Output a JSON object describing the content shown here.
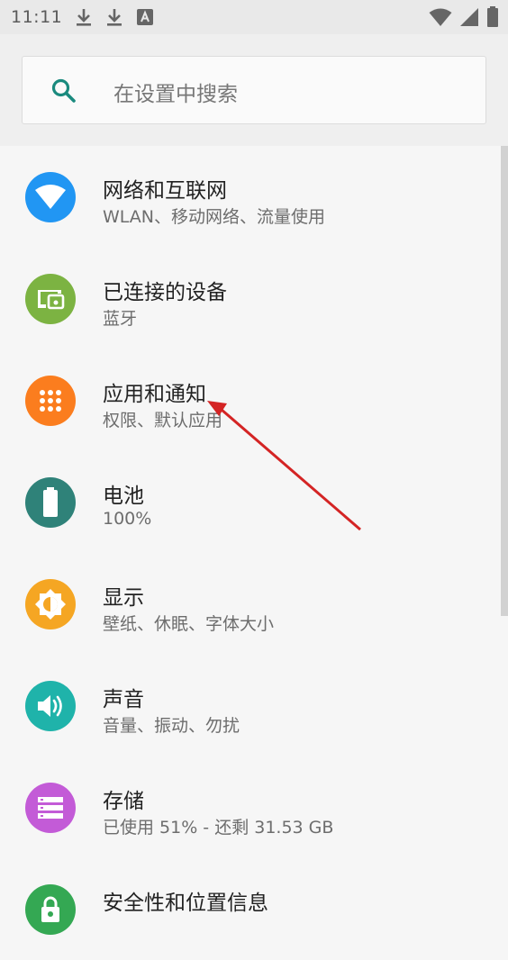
{
  "status_bar": {
    "time": "11:11",
    "icons": [
      "download-icon",
      "download-icon",
      "keyboard-a-icon",
      "wifi-icon",
      "signal-icon",
      "battery-icon"
    ]
  },
  "search": {
    "placeholder": "在设置中搜索",
    "icon": "search-icon"
  },
  "settings_items": [
    {
      "title": "网络和互联网",
      "subtitle": "WLAN、移动网络、流量使用",
      "icon": "wifi-icon",
      "color": "#2196f3"
    },
    {
      "title": "已连接的设备",
      "subtitle": "蓝牙",
      "icon": "devices-icon",
      "color": "#7cb342"
    },
    {
      "title": "应用和通知",
      "subtitle": "权限、默认应用",
      "icon": "apps-icon",
      "color": "#fb7d1e"
    },
    {
      "title": "电池",
      "subtitle": "100%",
      "icon": "battery-icon",
      "color": "#2f8279"
    },
    {
      "title": "显示",
      "subtitle": "壁纸、休眠、字体大小",
      "icon": "brightness-icon",
      "color": "#f5a623"
    },
    {
      "title": "声音",
      "subtitle": "音量、振动、勿扰",
      "icon": "volume-icon",
      "color": "#1fb3aa"
    },
    {
      "title": "存储",
      "subtitle": "已使用 51% - 还剩 31.53 GB",
      "icon": "storage-icon",
      "color": "#c35bd7"
    },
    {
      "title": "安全性和位置信息",
      "subtitle": "",
      "icon": "lock-icon",
      "color": "#34a853"
    }
  ],
  "annotation": {
    "type": "arrow",
    "color": "#d42424",
    "points_to": "应用和通知"
  }
}
